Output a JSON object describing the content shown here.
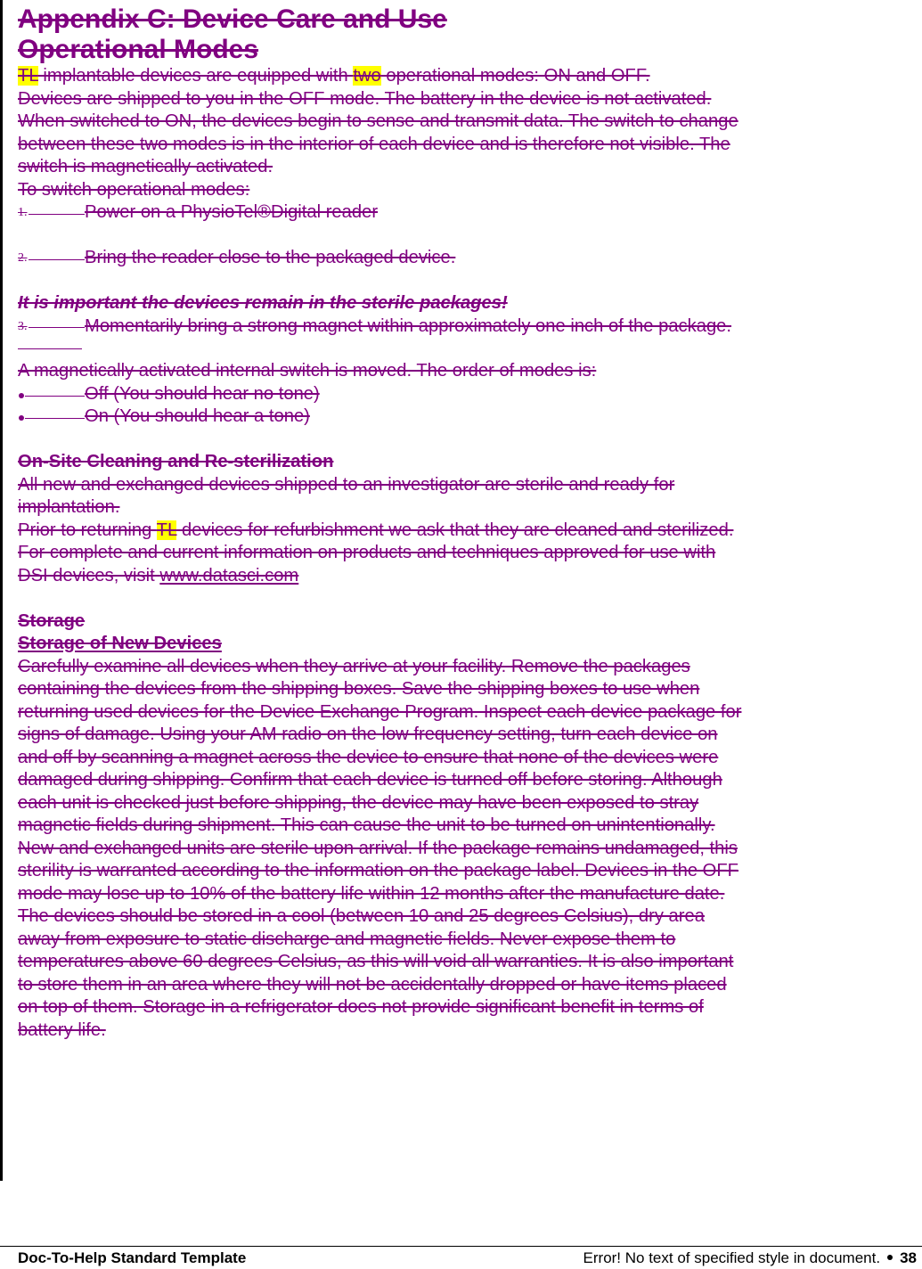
{
  "document": {
    "heading_line1": "Appendix C: Device Care and Use",
    "heading_line2": "Operational Modes",
    "intro": {
      "hl1": "TL",
      "part1": " implantable devices are equipped with ",
      "hl2": "two",
      "part2": " operational modes: ON and OFF."
    },
    "paragraph1_lines": [
      "Devices are shipped to you in the OFF mode. The battery in the device is not activated.",
      "When switched to ON, the devices begin to sense and transmit data. The switch to change",
      "between these two modes is in the interior of each device and is therefore not visible. The",
      "switch is magnetically activated."
    ],
    "steps_intro": "To switch operational modes:",
    "steps": [
      {
        "number": "1.",
        "text": "Power on a PhysioTel®Digital reader"
      },
      {
        "number": "2.",
        "text": "Bring the reader close to the packaged device."
      },
      {
        "number": "3.",
        "text": "Momentarily bring a strong magnet within approximately one inch of the package."
      }
    ],
    "warning": "It is important the devices remain in the sterile packages!",
    "modes_intro": "A magnetically activated internal switch is moved. The order of modes is:",
    "modes": [
      "Off (You should hear no tone)",
      "On (You should hear a tone)"
    ],
    "cleaning": {
      "heading": "On-Site Cleaning and Re-sterilization",
      "line1": "All new and exchanged devices shipped to an investigator are sterile and ready for",
      "line2": "implantation.",
      "line3_part1": "Prior to returning ",
      "line3_hl": "TL",
      "line3_part2": " devices for refurbishment we ask that they are cleaned and sterilized.",
      "line4": "For complete and current information on products and techniques approved for use with",
      "line5_part1": "DSI devices, visit ",
      "link": "www.datasci.com"
    },
    "storage": {
      "heading": "Storage",
      "subheading": "Storage of New Devices",
      "lines": [
        "Carefully examine all devices when they arrive at your facility. Remove the packages",
        "containing the devices from the shipping boxes. Save the shipping boxes to use when",
        "returning used devices for the Device Exchange Program. Inspect each device package for",
        "signs of damage. Using your AM radio on the low frequency setting, turn each device on",
        "and off by scanning a magnet across the device to ensure that none of the devices were",
        "damaged during shipping. Confirm that each device is turned off before storing. Although",
        "each unit is checked just before shipping, the device may have been exposed to stray",
        "magnetic fields during shipment. This can cause the unit to be turned on unintentionally.",
        "New and exchanged units are sterile upon arrival. If the package remains undamaged, this",
        "sterility is warranted according to the information on the package label. Devices in the OFF",
        "mode may lose up to 10% of the battery life within 12 months after the manufacture date.",
        "The devices should be stored in a cool (between 10 and 25 degrees Celsius), dry area",
        "away from exposure to static discharge and magnetic fields. Never expose them to",
        "temperatures above 60 degrees Celsius, as this will void all warranties. It is also important",
        "to store them in an area where they will not be accidentally dropped or have items placed",
        "on top of them. Storage in a refrigerator does not provide significant benefit in terms of",
        "battery life."
      ]
    }
  },
  "footer": {
    "left": "Doc-To-Help Standard Template",
    "right": "Error! No text of specified style in document.",
    "page_number": "38"
  },
  "colors": {
    "deleted_text": "#800080",
    "highlight": "#ffff00",
    "change_bar": "#000000"
  }
}
